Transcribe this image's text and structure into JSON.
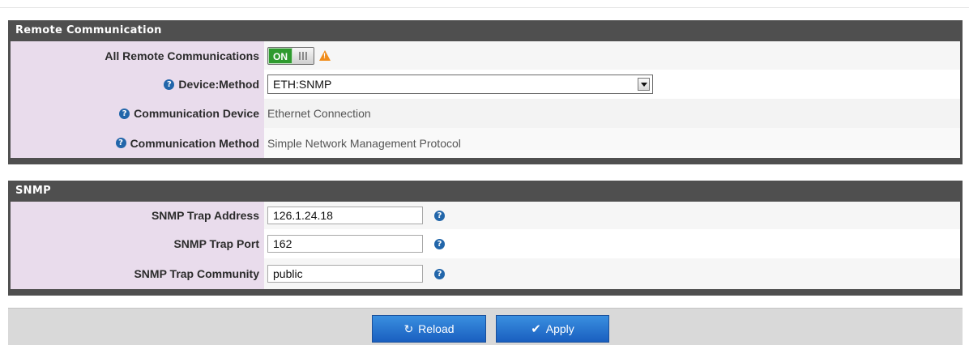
{
  "remote_section": {
    "title": "Remote Communication",
    "rows": {
      "all_remote": {
        "label": "All Remote Communications",
        "toggle_state": "ON"
      },
      "device_method": {
        "label": "Device:Method",
        "selected": "ETH:SNMP"
      },
      "comm_device": {
        "label": "Communication Device",
        "value": "Ethernet Connection"
      },
      "comm_method": {
        "label": "Communication Method",
        "value": "Simple Network Management Protocol"
      }
    }
  },
  "snmp_section": {
    "title": "SNMP",
    "rows": {
      "trap_address": {
        "label": "SNMP Trap Address",
        "value": "126.1.24.18"
      },
      "trap_port": {
        "label": "SNMP Trap Port",
        "value": "162"
      },
      "trap_community": {
        "label": "SNMP Trap Community",
        "value": "public"
      }
    }
  },
  "footer": {
    "reload_label": "Reload",
    "apply_label": "Apply"
  },
  "icons": {
    "help": "question-circle-icon",
    "warning": "warning-triangle-icon",
    "reload": "refresh-icon",
    "apply": "check-icon"
  },
  "colors": {
    "panel_header": "#4f4f4f",
    "label_bg": "#e9dcec",
    "toggle_on": "#2e9a2e",
    "button_blue": "#1a6fd0",
    "help_blue": "#2266aa",
    "warning": "#f08c1a"
  }
}
